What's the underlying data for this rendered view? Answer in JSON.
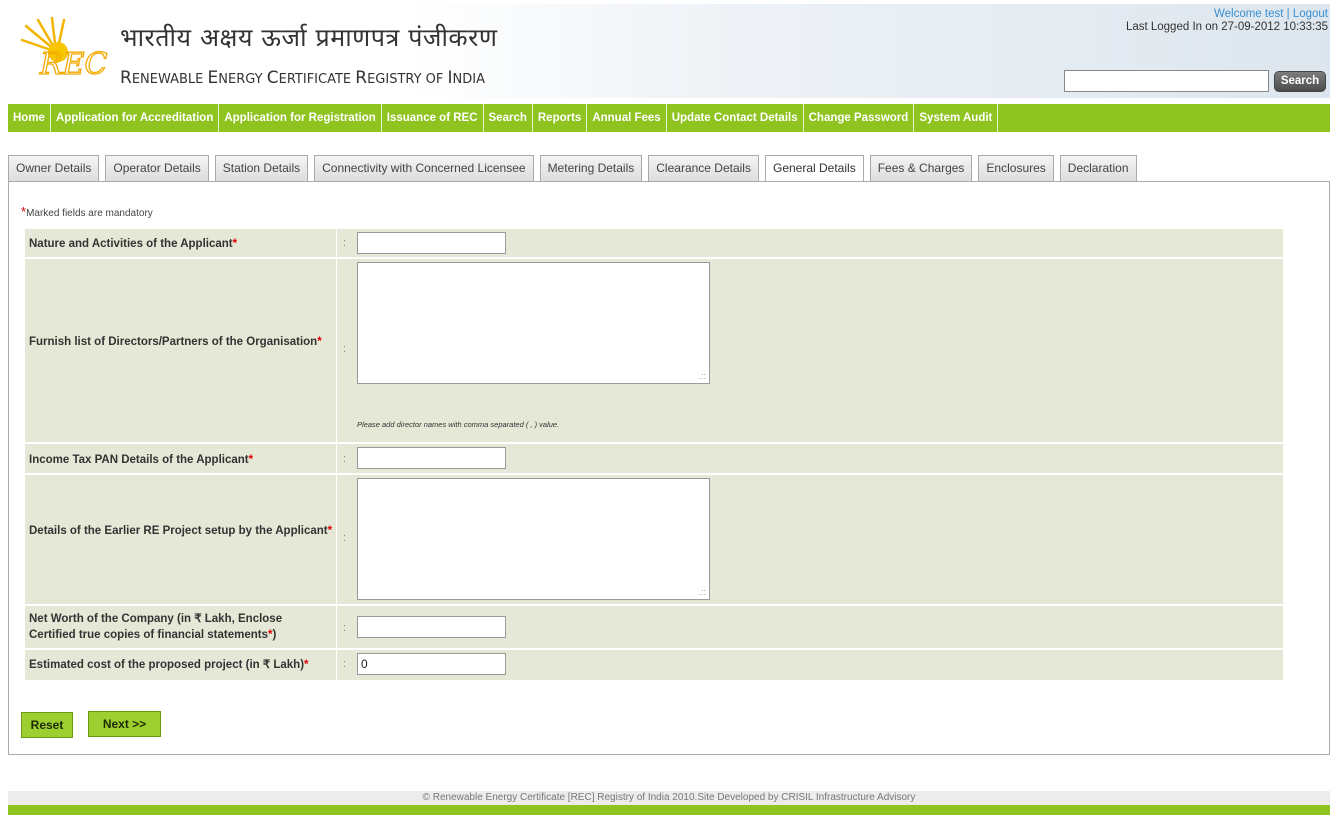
{
  "header": {
    "hindi_title": "भारतीय अक्षय ऊर्जा प्रमाणपत्र पंजीकरण",
    "eng_title_r": "R",
    "eng_title_1": "ENEWABLE ",
    "eng_title_e": "E",
    "eng_title_2": "NERGY ",
    "eng_title_c": "C",
    "eng_title_3": "ERTIFICATE ",
    "eng_title_rg": "R",
    "eng_title_4": "EGISTRY OF ",
    "eng_title_i": "I",
    "eng_title_5": "NDIA",
    "welcome": "Welcome test",
    "separator": " | ",
    "logout": "Logout",
    "last_login": "Last Logged In on 27-09-2012 10:33:35",
    "search_button": "Search",
    "logo_text": "REC"
  },
  "nav": {
    "items": [
      "Home",
      "Application for Accreditation",
      "Application for Registration",
      "Issuance of REC",
      "Search",
      "Reports",
      "Annual Fees",
      "Update Contact Details",
      "Change Password",
      "System Audit"
    ]
  },
  "tabs": [
    "Owner Details",
    "Operator Details",
    "Station Details",
    "Connectivity with Concerned Licensee",
    "Metering Details",
    "Clearance Details",
    "General Details",
    "Fees & Charges",
    "Enclosures",
    "Declaration"
  ],
  "active_tab": "General Details",
  "form": {
    "mandatory_note": "Marked fields are mandatory",
    "star": "*",
    "colon": ":",
    "nature_label": "Nature and Activities of the Applicant",
    "directors_label": "Furnish list of Directors/Partners of the Organisation",
    "directors_hint": "Please add director names with comma separated ( , ) value.",
    "pan_label": "Income Tax PAN Details of the Applicant",
    "earlier_label": "Details of the Earlier RE Project setup by the Applicant",
    "networth_label_1": "Net Worth of the Company (in ₹ Lakh, Enclose Certified true copies of financial statements",
    "networth_label_2": ")",
    "cost_label": "Estimated cost of the proposed project (in ₹ Lakh)",
    "cost_value": "0",
    "grip": ".::"
  },
  "buttons": {
    "reset": "Reset",
    "next": "Next >>"
  },
  "footer": {
    "text": "© Renewable Energy Certificate [REC] Registry of India 2010.Site Developed by CRISIL Infrastructure Advisory"
  },
  "colors": {
    "nav_green": "#8fc31f",
    "form_bg": "#e5e8d6",
    "required_red": "#d00000",
    "link_blue": "#3b8fcf"
  }
}
